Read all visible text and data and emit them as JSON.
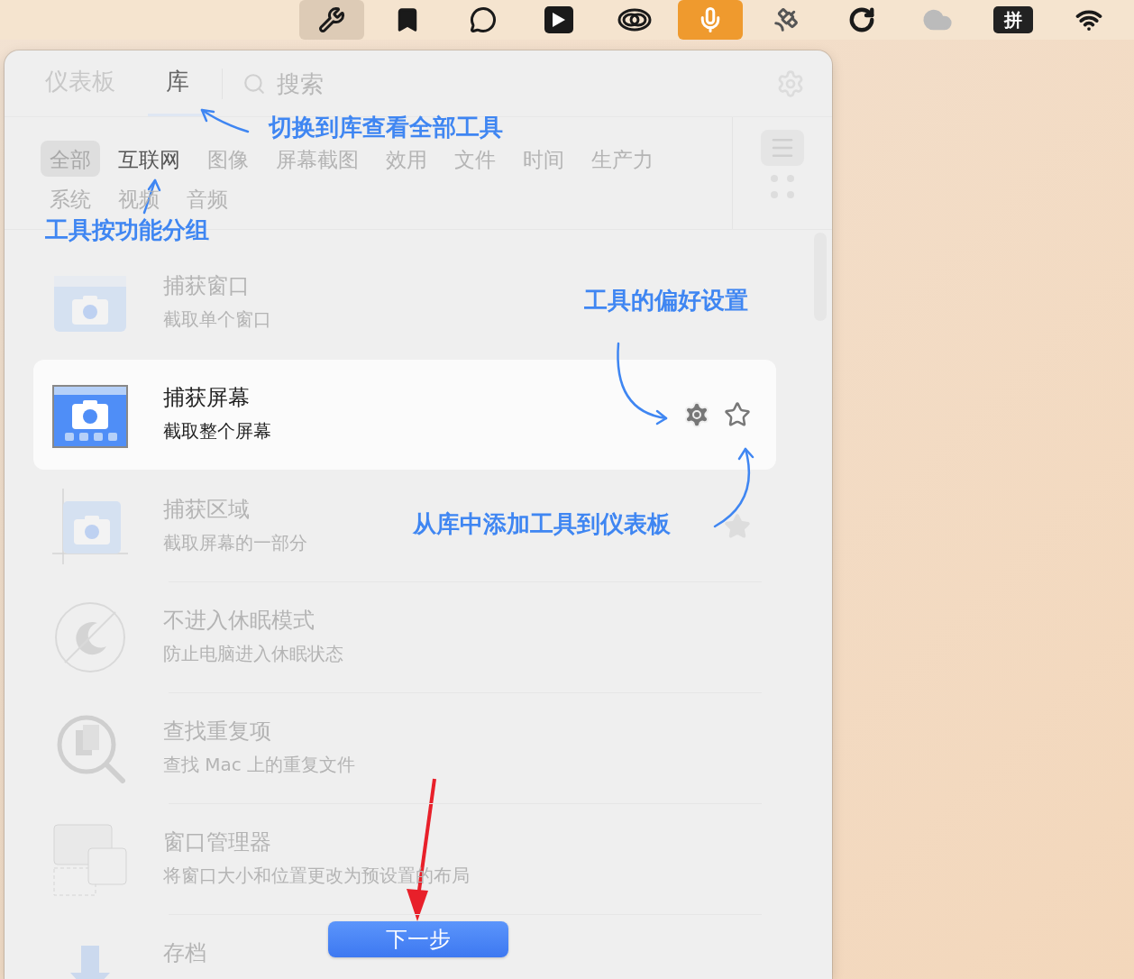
{
  "menu_bar": {
    "icons": [
      {
        "kind": "tools",
        "active": true
      },
      {
        "kind": "bookmark",
        "active": false
      },
      {
        "kind": "chat",
        "active": false
      },
      {
        "kind": "player",
        "active": false
      },
      {
        "kind": "cloud-rings",
        "active": false
      },
      {
        "kind": "mic",
        "active": true
      },
      {
        "kind": "satellite",
        "active": false
      },
      {
        "kind": "refresh",
        "active": false
      },
      {
        "kind": "cloud",
        "active": false
      },
      {
        "kind": "input-method",
        "label": "拼",
        "active": false
      },
      {
        "kind": "wifi",
        "active": false
      }
    ]
  },
  "tabs": [
    {
      "label": "仪表板",
      "selected": false
    },
    {
      "label": "库",
      "selected": true
    }
  ],
  "search": {
    "placeholder": "搜索"
  },
  "categories": [
    {
      "label": "全部",
      "selected": true,
      "highlighted": false
    },
    {
      "label": "互联网",
      "selected": false,
      "highlighted": true
    },
    {
      "label": "图像",
      "selected": false,
      "highlighted": false
    },
    {
      "label": "屏幕截图",
      "selected": false,
      "highlighted": false
    },
    {
      "label": "效用",
      "selected": false,
      "highlighted": false
    },
    {
      "label": "文件",
      "selected": false,
      "highlighted": false
    },
    {
      "label": "时间",
      "selected": false,
      "highlighted": false
    },
    {
      "label": "生产力",
      "selected": false,
      "highlighted": false
    },
    {
      "label": "系统",
      "selected": false,
      "highlighted": false
    },
    {
      "label": "视频",
      "selected": false,
      "highlighted": false
    },
    {
      "label": "音频",
      "selected": false,
      "highlighted": false
    }
  ],
  "tools": [
    {
      "kind": "window",
      "title": "捕获窗口",
      "description": "截取单个窗口",
      "focused": false,
      "favorite": false
    },
    {
      "kind": "screen",
      "title": "捕获屏幕",
      "description": "截取整个屏幕",
      "focused": true,
      "favorite": false
    },
    {
      "kind": "area",
      "title": "捕获区域",
      "description": "截取屏幕的一部分",
      "focused": false,
      "favorite": true
    },
    {
      "kind": "sleep",
      "title": "不进入休眠模式",
      "description": "防止电脑进入休眠状态",
      "focused": false,
      "favorite": false
    },
    {
      "kind": "duplicates",
      "title": "查找重复项",
      "description": "查找 Mac 上的重复文件",
      "focused": false,
      "favorite": false
    },
    {
      "kind": "window-manager",
      "title": "窗口管理器",
      "description": "将窗口大小和位置更改为预设置的布局",
      "focused": false,
      "favorite": false
    },
    {
      "kind": "archive",
      "title": "存档",
      "focused": false,
      "favorite": false
    }
  ],
  "annotations": [
    {
      "kind": "tabs",
      "text": "切换到库查看全部工具"
    },
    {
      "kind": "categories",
      "text": "工具按功能分组"
    },
    {
      "kind": "preferences",
      "text": "工具的偏好设置"
    },
    {
      "kind": "favorite",
      "text": "从库中添加工具到仪表板"
    },
    {
      "kind": "next"
    }
  ],
  "next_button": {
    "label": "下一步"
  }
}
